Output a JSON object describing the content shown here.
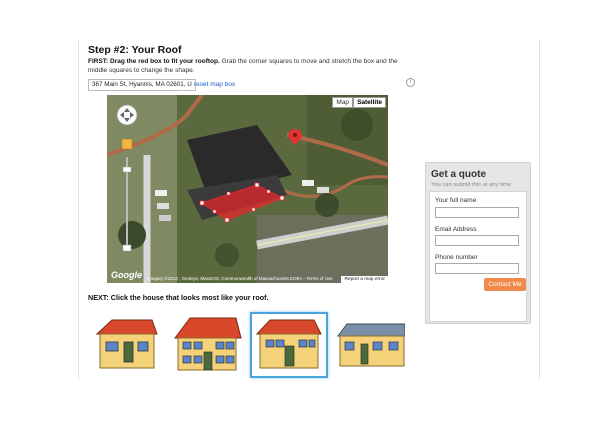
{
  "step": {
    "title": "Step #2: Your Roof",
    "instructions_bold": "FIRST: Drag the red box to fit your rooftop.",
    "instructions_rest": " Grab the corner squares to move and stretch the box and the middle squares to change the shape."
  },
  "address": {
    "value": "367 Main St, Hyannis, MA 02601, US",
    "reset_label": "reset map box",
    "info_icon": "i"
  },
  "map": {
    "type_buttons": [
      "Map",
      "Satellite"
    ],
    "selected_type": "Satellite",
    "logo": "Google",
    "attribution": "Imagery ©2012 , GeoEye, MassGIS, Commonwealth of Massachusetts EOEA - Terms of Use",
    "report_label": "Report a map error",
    "pan_icon": "pan-control-icon",
    "zoom_in": "+",
    "zoom_out": "−"
  },
  "next": {
    "label": "NEXT: Click the house that looks most like your roof.",
    "houses": [
      {
        "roof_color": "#d9482a",
        "selected": false
      },
      {
        "roof_color": "#d9482a",
        "selected": false
      },
      {
        "roof_color": "#d9482a",
        "selected": true
      },
      {
        "roof_color": "#7b8fa6",
        "selected": false
      }
    ]
  },
  "quote": {
    "title": "Get a quote",
    "subtitle": "You can submit this at any time",
    "name_label": "Your full name",
    "email_label": "Email Address",
    "phone_label": "Phone number",
    "button_label": "Contact Me",
    "button_color": "#f08a4b"
  }
}
